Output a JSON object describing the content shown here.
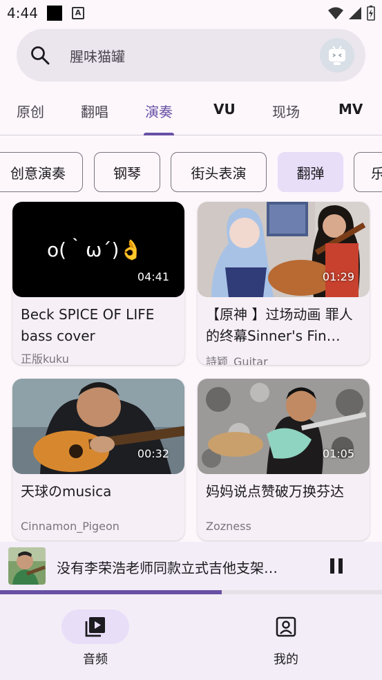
{
  "status_bar": {
    "time": "4:44"
  },
  "search": {
    "placeholder": "腥味猫罐"
  },
  "tabs": [
    {
      "label": "原创"
    },
    {
      "label": "翻唱"
    },
    {
      "label": "演奏",
      "active": true
    },
    {
      "label": "VU"
    },
    {
      "label": "现场"
    },
    {
      "label": "MV"
    }
  ],
  "chips": [
    {
      "label": "创意演奏"
    },
    {
      "label": "钢琴"
    },
    {
      "label": "街头表演"
    },
    {
      "label": "翻弹",
      "selected": true
    },
    {
      "label": "乐"
    }
  ],
  "videos": [
    {
      "title": "Beck SPICE OF LIFE bass cover",
      "author": "正版kuku",
      "duration": "04:41",
      "thumb_text": "o(｀ω´)👌"
    },
    {
      "title": "【原神 】过场动画 罪人的终幕Sinner's Fin…",
      "author": "詩颖_Guitar",
      "duration": "01:29"
    },
    {
      "title": "天球のmusica",
      "author": "Cinnamon_Pigeon",
      "duration": "00:32"
    },
    {
      "title": "妈妈说点赞破万换芬达",
      "author": "Zozness",
      "duration": "01:05"
    }
  ],
  "player": {
    "title": "没有李荣浩老师同款立式吉他支架…",
    "progress": 0.58
  },
  "bottom_nav": [
    {
      "label": "音频",
      "icon": "play-library-icon",
      "active": true
    },
    {
      "label": "我的",
      "icon": "account-box-icon"
    }
  ],
  "colors": {
    "accent": "#6750a4",
    "chip_selected": "#e8def8",
    "background": "#fdf7fc"
  }
}
